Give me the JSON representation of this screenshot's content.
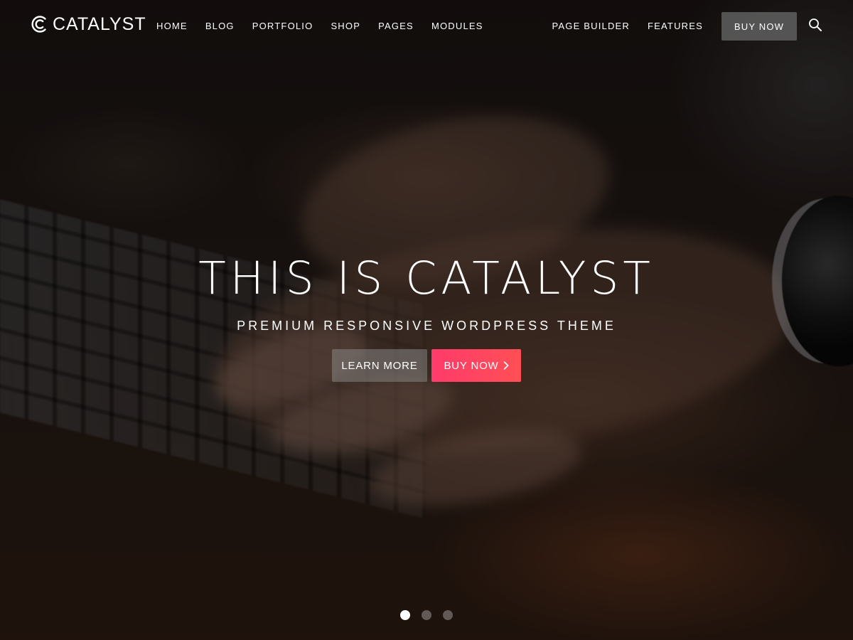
{
  "brand": {
    "name": "CATALYST",
    "logo_icon": "catalyst-c-logo-icon"
  },
  "nav": {
    "left": [
      {
        "label": "HOME"
      },
      {
        "label": "BLOG"
      },
      {
        "label": "PORTFOLIO"
      },
      {
        "label": "SHOP"
      },
      {
        "label": "PAGES"
      },
      {
        "label": "MODULES"
      }
    ],
    "right": [
      {
        "label": "PAGE BUILDER"
      },
      {
        "label": "FEATURES"
      }
    ],
    "buy_now": "BUY NOW",
    "search_icon": "search-icon"
  },
  "hero": {
    "title": "THIS IS CATALYST",
    "subtitle": "PREMIUM RESPONSIVE WORDPRESS THEME",
    "learn_more": "LEARN MORE",
    "buy_now": "BUY NOW",
    "buy_icon": "chevron-right-icon"
  },
  "slider": {
    "slides": 3,
    "active": 1
  },
  "colors": {
    "accent_start": "#ff3b6b",
    "accent_end": "#ff4f55",
    "header_button": "#5f5f5f",
    "text": "#ffffff"
  }
}
